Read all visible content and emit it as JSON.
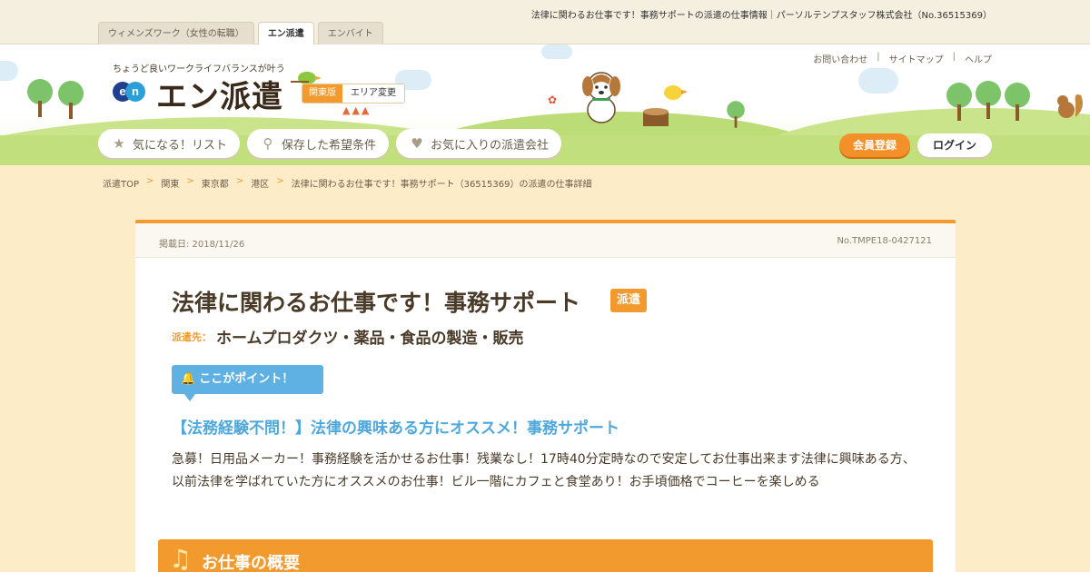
{
  "site_tabs": [
    {
      "label": "ウィメンズワーク（女性の転職）",
      "active": false
    },
    {
      "label": "エン派遣",
      "active": true
    },
    {
      "label": "エンバイト",
      "active": false
    }
  ],
  "page_heading": "法律に関わるお仕事です！事務サポートの派遣の仕事情報｜パーソルテンプスタッフ株式会社（No.36515369）",
  "header": {
    "tagline": "ちょうど良いワークライフバランスが叶う",
    "logo_mark_e": "e",
    "logo_mark_n": "n",
    "logo_text": "エン派遣",
    "region_current": "関東版",
    "region_change": "エリア変更"
  },
  "util_links": [
    "お問い合わせ",
    "サイトマップ",
    "ヘルプ"
  ],
  "util_separator": "|",
  "nav_pills": [
    {
      "label": "気になる！リスト",
      "icon": "star-icon",
      "glyph": "★"
    },
    {
      "label": "保存した希望条件",
      "icon": "search-icon",
      "glyph": "⚲"
    },
    {
      "label": "お気に入りの派遣会社",
      "icon": "heart-icon",
      "glyph": "♥"
    }
  ],
  "auth": {
    "register": "会員登録",
    "login": "ログイン"
  },
  "breadcrumb": {
    "items": [
      "派遣TOP",
      "関東",
      "東京都",
      "港区",
      "法律に関わるお仕事です！事務サポート（36515369）の派遣の仕事詳細"
    ],
    "separator": ">"
  },
  "job": {
    "posted": "掲載日: 2018/11/26",
    "number": "No.TMPE18-0427121",
    "title": "法律に関わるお仕事です！事務サポート",
    "badge": "派遣",
    "company_label": "派遣先：",
    "company": "ホームプロダクツ・薬品・食品の製造・販売",
    "point_label": "ここがポイント！",
    "catch": "【法務経験不問！】法律の興味ある方にオススメ！事務サポート",
    "description": "急募！日用品メーカー！事務経験を活かせるお仕事！残業なし！17時40分定時なので安定してお仕事出来ます法律に興味ある方、以前法律を学ばれていた方にオススメのお仕事！ビル一階にカフェと食堂あり！お手頃価格でコーヒーを楽しめる",
    "section_title": "お仕事の概要"
  },
  "colors": {
    "accent": "#f29a2e",
    "point_blue": "#5fb0e3",
    "catch_blue": "#4fa8dc",
    "background": "#fdecc8",
    "text": "#4a3a28"
  }
}
